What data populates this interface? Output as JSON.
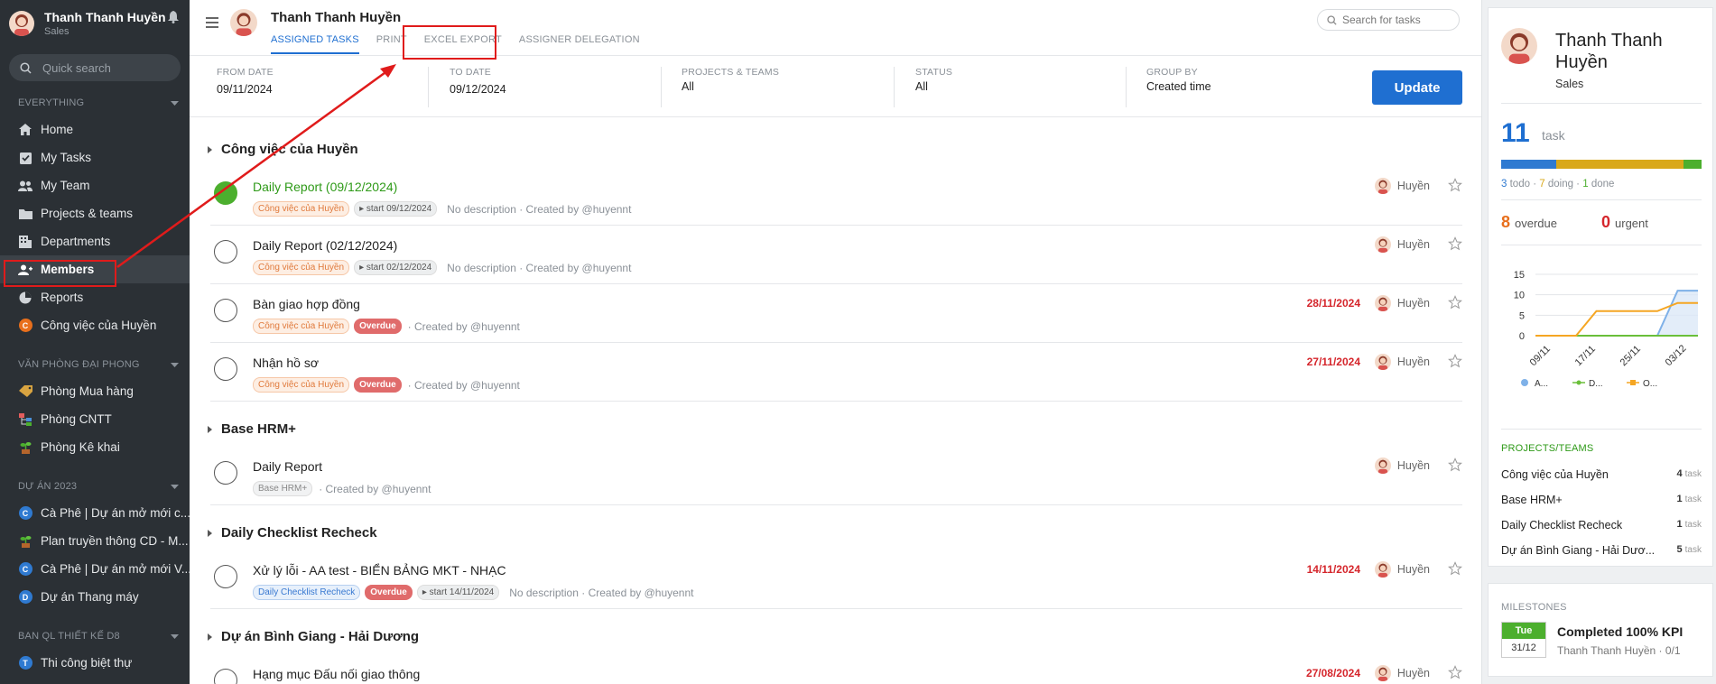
{
  "sidebar": {
    "user": {
      "name": "Thanh Thanh Huyền",
      "role": "Sales"
    },
    "search_placeholder": "Quick search",
    "sections": {
      "everything": "EVERYTHING",
      "vanphong": "VĂN PHÒNG ĐẠI PHONG",
      "duan": "DỰ ÁN 2023",
      "banql": "BAN QL THIẾT KẾ D8"
    },
    "items": [
      {
        "label": "Home"
      },
      {
        "label": "My Tasks"
      },
      {
        "label": "My Team"
      },
      {
        "label": "Projects & teams"
      },
      {
        "label": "Departments"
      },
      {
        "label": "Members"
      },
      {
        "label": "Reports"
      },
      {
        "label": "Công việc của Huyền",
        "badge": "C"
      }
    ],
    "office_items": [
      {
        "label": "Phòng Mua hàng"
      },
      {
        "label": "Phòng CNTT"
      },
      {
        "label": "Phòng Kê khai"
      }
    ],
    "project_items": [
      {
        "label": "Cà Phê | Dự án mở mới c...",
        "badge": "C"
      },
      {
        "label": "Plan truyền thông CD - M..."
      },
      {
        "label": "Cà Phê | Dự án mở mới V...",
        "badge": "C"
      },
      {
        "label": "Dự án Thang máy",
        "badge": "D"
      }
    ],
    "design_items": [
      {
        "label": "Thi công biệt thự",
        "badge": "T"
      }
    ]
  },
  "header": {
    "name": "Thanh Thanh Huyền",
    "tabs": [
      "ASSIGNED TASKS",
      "PRINT",
      "EXCEL EXPORT",
      "ASSIGNER DELEGATION"
    ],
    "search_placeholder": "Search for tasks"
  },
  "filters": {
    "from_label": "FROM DATE",
    "from_value": "09/11/2024",
    "to_label": "TO DATE",
    "to_value": "09/12/2024",
    "projects_label": "PROJECTS & TEAMS",
    "projects_value": "All",
    "status_label": "STATUS",
    "status_value": "All",
    "group_label": "GROUP BY",
    "group_value": "Created time",
    "update_label": "Update"
  },
  "groups": [
    {
      "title": "Công việc của Huyền",
      "tasks": [
        {
          "title": "Daily Report (09/12/2024)",
          "chip": "Công việc của Huyền",
          "start": "start 09/12/2024",
          "desc": "No description · Created by @huyennt",
          "user": "Huyền"
        },
        {
          "title": "Daily Report (02/12/2024)",
          "chip": "Công việc của Huyền",
          "start": "start 02/12/2024",
          "desc": "No description · Created by @huyennt",
          "user": "Huyền"
        },
        {
          "title": "Bàn giao hợp đồng",
          "chip": "Công việc của Huyền",
          "overdue": "Overdue",
          "desc": "· Created by @huyennt",
          "due": "28/11/2024",
          "user": "Huyền"
        },
        {
          "title": "Nhận hồ sơ",
          "chip": "Công việc của Huyền",
          "overdue": "Overdue",
          "desc": "· Created by @huyennt",
          "due": "27/11/2024",
          "user": "Huyền"
        }
      ]
    },
    {
      "title": "Base HRM+",
      "tasks": [
        {
          "title": "Daily Report",
          "chip": "Base HRM+",
          "desc": "· Created by @huyennt",
          "user": "Huyền"
        }
      ]
    },
    {
      "title": "Daily Checklist Recheck",
      "tasks": [
        {
          "title": "Xử lý lỗi - AA test - BIỂN BẢNG MKT - NHẠC",
          "chip": "Daily Checklist Recheck",
          "overdue": "Overdue",
          "start": "start 14/11/2024",
          "desc": "No description · Created by @huyennt",
          "due": "14/11/2024",
          "user": "Huyền"
        }
      ]
    },
    {
      "title": "Dự án Bình Giang - Hải Dương",
      "tasks": [
        {
          "title": "Hạng mục Đấu nối giao thông",
          "due": "27/08/2024",
          "user": "Huyền"
        }
      ]
    }
  ],
  "right": {
    "name_line1": "Thanh Thanh",
    "name_line2": "Huyền",
    "role": "Sales",
    "count": "11",
    "count_label": "task",
    "todo_n": "3",
    "todo_l": "todo",
    "doing_n": "7",
    "doing_l": "doing",
    "done_n": "1",
    "done_l": "done",
    "overdue_n": "8",
    "overdue_l": "overdue",
    "urgent_n": "0",
    "urgent_l": "urgent",
    "projects_title": "PROJECTS/TEAMS",
    "projects": [
      {
        "name": "Công việc của Huyền",
        "count": "4",
        "unit": "task"
      },
      {
        "name": "Base HRM+",
        "count": "1",
        "unit": "task"
      },
      {
        "name": "Daily Checklist Recheck",
        "count": "1",
        "unit": "task"
      },
      {
        "name": "Dự án Bình Giang - Hải Dươ...",
        "count": "5",
        "unit": "task"
      }
    ],
    "milestones_title": "MILESTONES",
    "milestone": {
      "day": "Tue",
      "date": "31/12",
      "name": "Completed 100% KPI",
      "owner": "Thanh Thanh Huyền",
      "progress": "0/1"
    }
  },
  "colors": {
    "accent": "#1f6fd1",
    "done": "#4caf2e",
    "doing": "#d9a81a",
    "overdue": "#e06b6b",
    "annotation": "#e01b1b"
  },
  "chart_data": {
    "type": "line",
    "x": [
      "09/11",
      "17/11",
      "25/11",
      "03/12"
    ],
    "ylim": [
      0,
      15
    ],
    "yticks": [
      0,
      5,
      10,
      15
    ],
    "series": [
      {
        "name": "A...",
        "color": "#7fb1e8",
        "values": [
          0,
          0,
          0,
          0,
          0,
          0,
          0,
          11,
          11
        ]
      },
      {
        "name": "D...",
        "color": "#6abf3a",
        "values": [
          0,
          0,
          0,
          0,
          0,
          0,
          0,
          0,
          0
        ]
      },
      {
        "name": "O...",
        "color": "#f5a623",
        "values": [
          0,
          0,
          0,
          6,
          6,
          6,
          6,
          8,
          8
        ]
      }
    ]
  }
}
